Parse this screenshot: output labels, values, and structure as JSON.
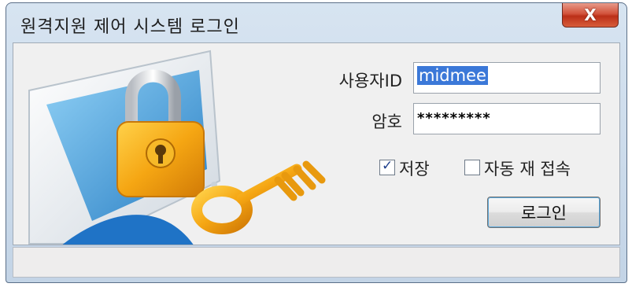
{
  "window": {
    "title": "원격지원 제어 시스템 로그인",
    "close_icon": "close-icon",
    "close_glyph": "X"
  },
  "form": {
    "user_id_label": "사용자ID",
    "user_id_value": "midmee",
    "password_label": "암호",
    "password_value": "*********",
    "save_label": "저장",
    "save_checked": true,
    "auto_reconnect_label": "자동 재 접속",
    "auto_reconnect_checked": false,
    "login_button_label": "로그인"
  },
  "illustration": {
    "icon": "lock-and-key-illustration"
  },
  "colors": {
    "accent": "#3b78d8",
    "lock": "#f2a91a",
    "monitor": "#3a8fd0"
  }
}
